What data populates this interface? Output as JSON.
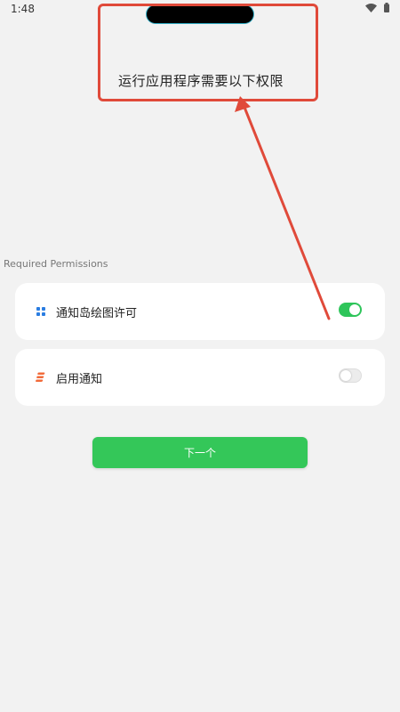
{
  "status_bar": {
    "time": "1:48",
    "icons": [
      "wifi-icon",
      "battery-icon"
    ]
  },
  "overlay": {
    "headline": "运行应用程序需要以下权限",
    "annotation_color": "#e04a3a"
  },
  "permissions": {
    "section_title": "Required Permissions",
    "items": [
      {
        "label": "通知岛绘图许可",
        "icon": "grid-icon",
        "enabled": true
      },
      {
        "label": "启用通知",
        "icon": "notification-stack-icon",
        "enabled": false
      }
    ]
  },
  "actions": {
    "next_label": "下一个"
  },
  "colors": {
    "accent_green": "#34c759",
    "toggle_on": "#2ec55a",
    "grid_icon_blue": "#2a7de1",
    "notification_icon_orange": "#f26b3a",
    "background": "#f2f2f2"
  }
}
